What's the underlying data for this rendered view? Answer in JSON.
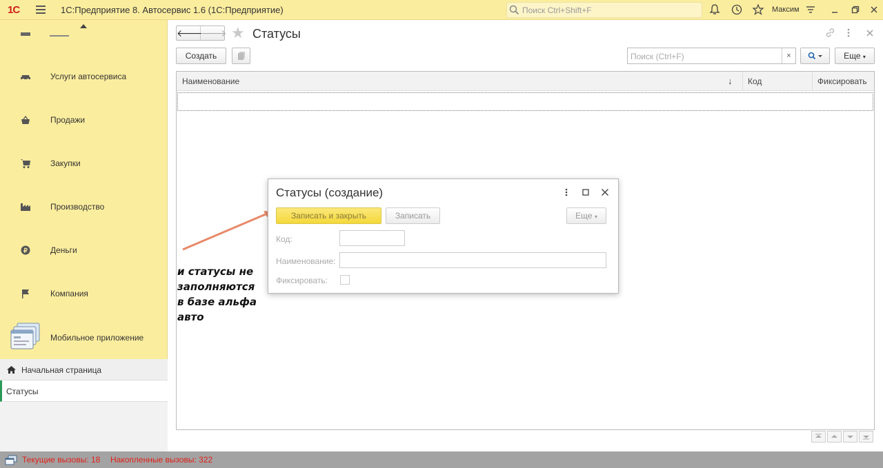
{
  "topbar": {
    "logo": "1С",
    "app_title": "1С:Предприятие 8. Автосервис 1.6  (1С:Предприятие)",
    "search_placeholder": "Поиск Ctrl+Shift+F",
    "user_name": "Максим",
    "bg_color": "#fbed9e"
  },
  "sidebar": {
    "items": [
      {
        "label": "Услуги автосервиса",
        "icon": "car-icon"
      },
      {
        "label": "Продажи",
        "icon": "basket-icon"
      },
      {
        "label": "Закупки",
        "icon": "cart-icon"
      },
      {
        "label": "Производство",
        "icon": "factory-icon"
      },
      {
        "label": "Деньги",
        "icon": "coin-icon"
      },
      {
        "label": "Компания",
        "icon": "flag-icon"
      },
      {
        "label": "Мобильное приложение",
        "icon": "mobile-app-icon"
      }
    ],
    "open_windows": {
      "home": "Начальная страница",
      "current": "Статусы"
    }
  },
  "main": {
    "title": "Статусы",
    "create_button": "Создать",
    "search_placeholder": "Поиск (Ctrl+F)",
    "clear_symbol": "×",
    "more_button": "Еще",
    "columns": [
      "Наименование",
      "Код",
      "Фиксировать"
    ],
    "sort_indicator": "↓"
  },
  "modal": {
    "title": "Статусы (создание)",
    "save_close_button": "Записать и закрыть",
    "save_button": "Записать",
    "more_button": "Еще",
    "fields": {
      "code_label": "Код:",
      "name_label": "Наименование:",
      "fixed_label": "Фиксировать:"
    }
  },
  "annotation": {
    "text_line1": "и статусы не",
    "text_line2": "заполняются",
    "text_line3": "в базе альфа",
    "text_line4": "авто",
    "arrow_color": "#e8896a"
  },
  "statusbar": {
    "current_calls": "Текущие вызовы: 18",
    "accumulated_calls": "Накопленные вызовы: 322",
    "text_color": "#e0201a"
  }
}
